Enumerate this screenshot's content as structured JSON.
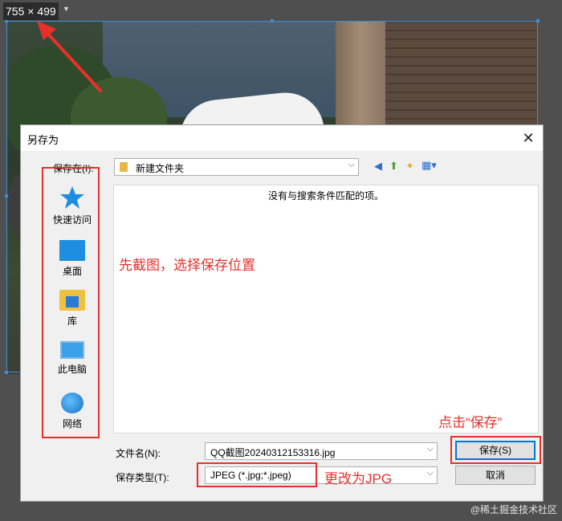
{
  "screenshot_size_label": "755 × 499",
  "dialog": {
    "title": "另存为",
    "close_glyph": "✕",
    "save_in_label": "保存在(I):",
    "save_in_value": "新建文件夹",
    "empty_message": "没有与搜索条件匹配的项。",
    "places": [
      {
        "label": "快速访问",
        "icon": "star-icon"
      },
      {
        "label": "桌面",
        "icon": "desktop-icon"
      },
      {
        "label": "库",
        "icon": "library-icon"
      },
      {
        "label": "此电脑",
        "icon": "computer-icon"
      },
      {
        "label": "网络",
        "icon": "network-icon"
      }
    ],
    "filename_label": "文件名(N):",
    "filename_value": "QQ截图20240312153316.jpg",
    "filetype_label": "保存类型(T):",
    "filetype_value": "JPEG (*.jpg;*.jpeg)",
    "save_button": "保存(S)",
    "cancel_button": "取消"
  },
  "annotations": {
    "step1": "先截图，选择保存位置",
    "step2": "点击“保存”",
    "step3": "更改为JPG"
  },
  "watermark": "@稀土掘金技术社区",
  "colors": {
    "annotation": "#e8302b",
    "selection": "#3c8fd9"
  }
}
